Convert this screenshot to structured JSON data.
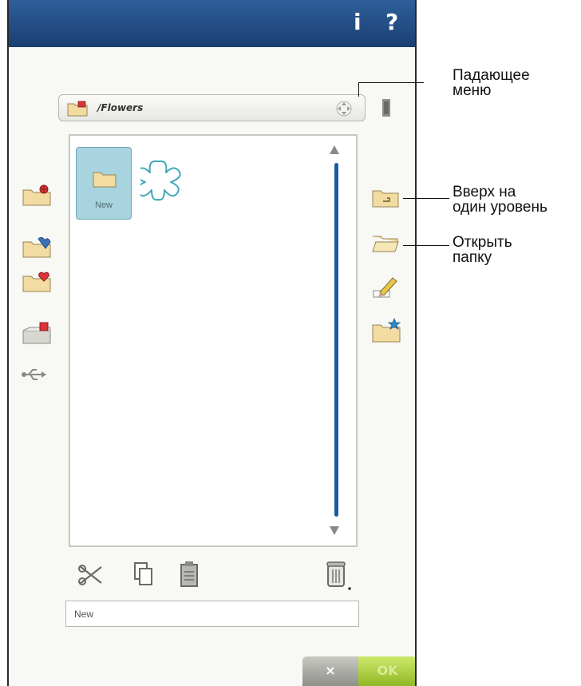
{
  "titlebar": {
    "info_label": "i",
    "help_label": "?"
  },
  "path_bar": {
    "path": "/Flowers"
  },
  "file_list": {
    "items": [
      {
        "label": "New",
        "type": "folder",
        "selected": true
      },
      {
        "label": "",
        "type": "design-flower-outline"
      }
    ]
  },
  "name_field": {
    "value": "New"
  },
  "buttons": {
    "cancel_label": "×",
    "ok_label": "OK"
  },
  "callouts": {
    "dropdown": "Падающее\nменю",
    "up_one_level": "Вверх на\nодин уровень",
    "open_folder": "Открыть\nпапку"
  },
  "colors": {
    "title_bar": "#1f4a85",
    "accent": "#1c5aa8",
    "selection": "#a7d4df",
    "ok_button": "#a6cf3a"
  }
}
